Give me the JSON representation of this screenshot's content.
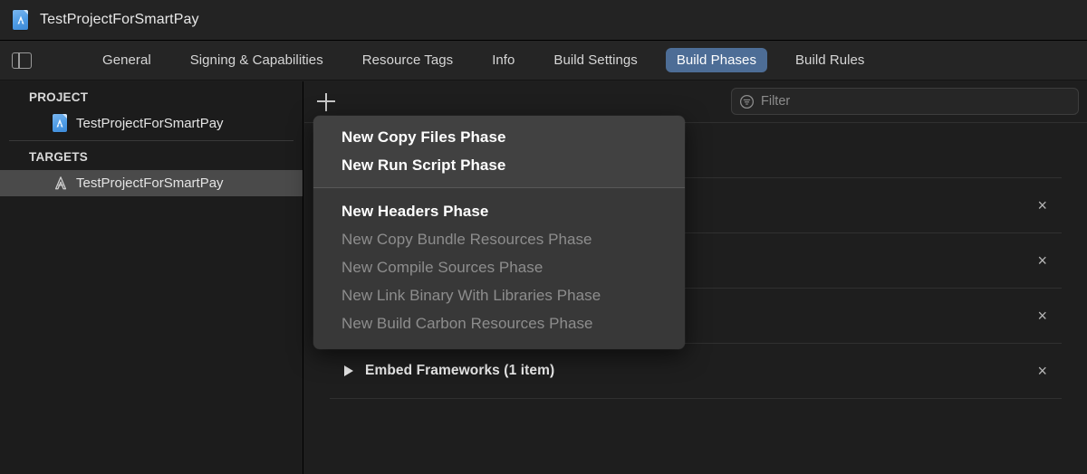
{
  "titlebar": {
    "title": "TestProjectForSmartPay",
    "icon": "xcode-project-document-icon"
  },
  "tabbar": {
    "sidebar_toggle_icon": "sidebar-toggle-icon",
    "tabs": [
      {
        "label": "General",
        "active": false
      },
      {
        "label": "Signing & Capabilities",
        "active": false
      },
      {
        "label": "Resource Tags",
        "active": false
      },
      {
        "label": "Info",
        "active": false
      },
      {
        "label": "Build Settings",
        "active": false
      },
      {
        "label": "Build Phases",
        "active": true
      },
      {
        "label": "Build Rules",
        "active": false
      }
    ],
    "active_tab_color": "#4d6d96"
  },
  "sidebar": {
    "groups": [
      {
        "title": "PROJECT",
        "items": [
          {
            "label": "TestProjectForSmartPay",
            "icon": "project-document-icon",
            "selected": false
          }
        ]
      },
      {
        "title": "TARGETS",
        "items": [
          {
            "label": "TestProjectForSmartPay",
            "icon": "app-target-icon",
            "selected": true
          }
        ]
      }
    ],
    "selection_color": "#4a4a4a"
  },
  "toolbar": {
    "add_button_icon": "plus-icon",
    "add_button_label": "+",
    "filter": {
      "icon": "filter-icon",
      "placeholder": "Filter",
      "value": ""
    }
  },
  "phases": [
    {
      "title": "",
      "close_label": "",
      "hidden": true
    },
    {
      "title": "",
      "close_label": "×",
      "hidden": true
    },
    {
      "title": "",
      "close_label": "×",
      "hidden": true
    },
    {
      "title": "",
      "close_label": "×",
      "hidden": true
    },
    {
      "title": "Embed Frameworks (1 item)",
      "close_label": "×",
      "hidden": false
    }
  ],
  "menu": {
    "top_items": [
      {
        "label": "New Copy Files Phase",
        "disabled": false
      },
      {
        "label": "New Run Script Phase",
        "disabled": false
      }
    ],
    "bottom_items": [
      {
        "label": "New Headers Phase",
        "disabled": false
      },
      {
        "label": "New Copy Bundle Resources Phase",
        "disabled": true
      },
      {
        "label": "New Compile Sources Phase",
        "disabled": true
      },
      {
        "label": "New Link Binary With Libraries Phase",
        "disabled": true
      },
      {
        "label": "New Build Carbon Resources Phase",
        "disabled": true
      }
    ]
  }
}
